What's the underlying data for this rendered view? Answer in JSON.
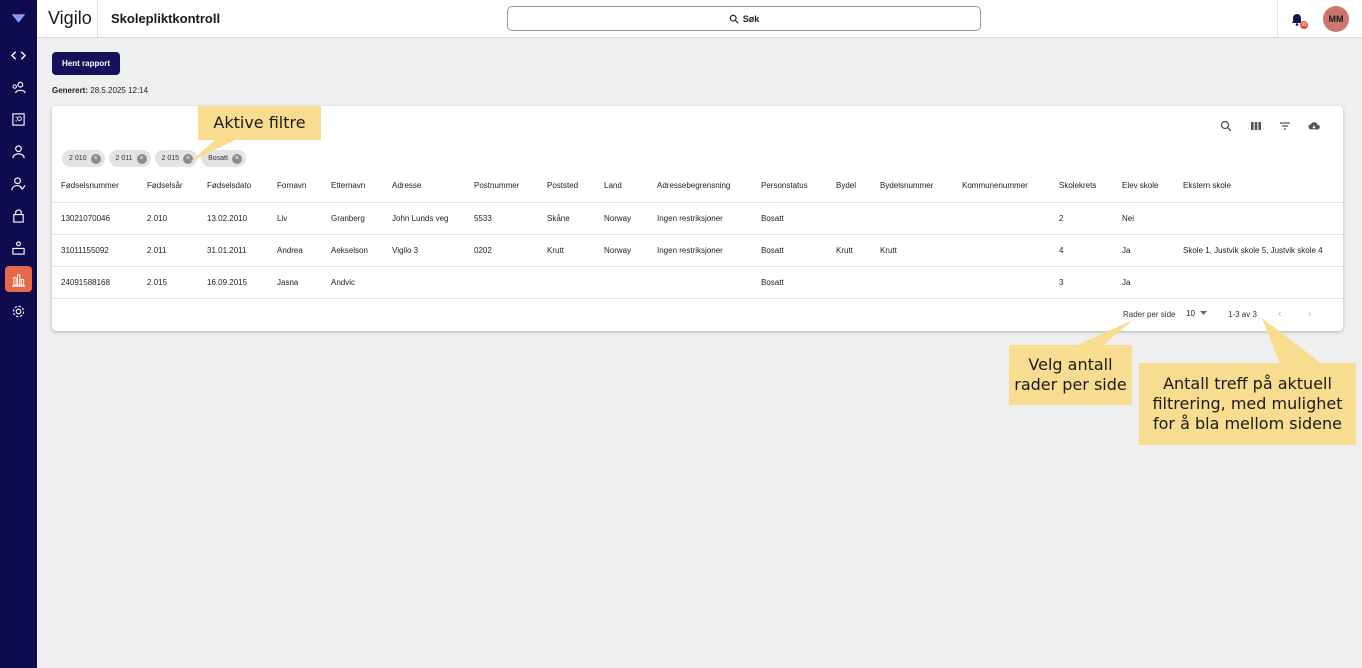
{
  "app": {
    "brand": "Vigilo",
    "title": "Skolepliktkontroll",
    "search_label": "Søk",
    "notification_count": "99",
    "user_initials": "MM"
  },
  "sidebar": {
    "items": [
      {
        "icon": "code-brackets-icon"
      },
      {
        "icon": "users-icon"
      },
      {
        "icon": "attendance-icon"
      },
      {
        "icon": "person-icon"
      },
      {
        "icon": "person-check-icon"
      },
      {
        "icon": "lock-icon"
      },
      {
        "icon": "podium-icon"
      },
      {
        "icon": "bar-chart-icon",
        "active": true
      },
      {
        "icon": "gear-icon"
      }
    ]
  },
  "actions": {
    "fetch_report_label": "Hent rapport",
    "generated_label": "Generert:",
    "generated_value": "28.5.2025 12:14"
  },
  "filters": {
    "chips": [
      "2 010",
      "2 011",
      "2 015",
      "Bosatt"
    ]
  },
  "table": {
    "columns": [
      "Fødselsnummer",
      "Fødselsår",
      "Fødselsdato",
      "Fornavn",
      "Etternavn",
      "Adresse",
      "Postnummer",
      "Poststed",
      "Land",
      "Adressebegrensning",
      "Personstatus",
      "Bydel",
      "Bydelsnummer",
      "Kommunenummer",
      "Skolekrets",
      "Elev skole",
      "Ekstern skole"
    ],
    "rows": [
      [
        "13021070046",
        "2 010",
        "13.02.2010",
        "Liv",
        "Granberg",
        "John Lunds veg",
        "5533",
        "Skåne",
        "Norway",
        "Ingen restriksjoner",
        "Bosatt",
        "",
        "",
        "",
        "2",
        "Nei",
        ""
      ],
      [
        "31011155092",
        "2 011",
        "31.01.2011",
        "Andrea",
        "Aekselson",
        "Vigilo 3",
        "0202",
        "Krutt",
        "Norway",
        "Ingen restriksjoner",
        "Bosatt",
        "Krutt",
        "Krutt",
        "",
        "4",
        "Ja",
        "Skole 1, Justvik skole 5, Justvik skole 4"
      ],
      [
        "24091588168",
        "2 015",
        "16.09.2015",
        "Jasna",
        "Andvic",
        "",
        "",
        "",
        "",
        "",
        "Bosatt",
        "",
        "",
        "",
        "3",
        "Ja",
        ""
      ]
    ]
  },
  "pagination": {
    "rows_per_page_label": "Rader per side",
    "rows_per_page_value": "10",
    "range_text": "1-3 av 3"
  },
  "callouts": {
    "active_filters": "Aktive filtre",
    "rows_per_page": "Velg antall rader per side",
    "hit_count": "Antall treff på aktuell filtrering, med mulighet for å bla mellom sidene"
  },
  "colors": {
    "rail": "#0f0b4f",
    "active_nav": "#e56a4b",
    "primary_button": "#15115a",
    "callout": "#f8dc8f",
    "avatar": "#c97871"
  }
}
